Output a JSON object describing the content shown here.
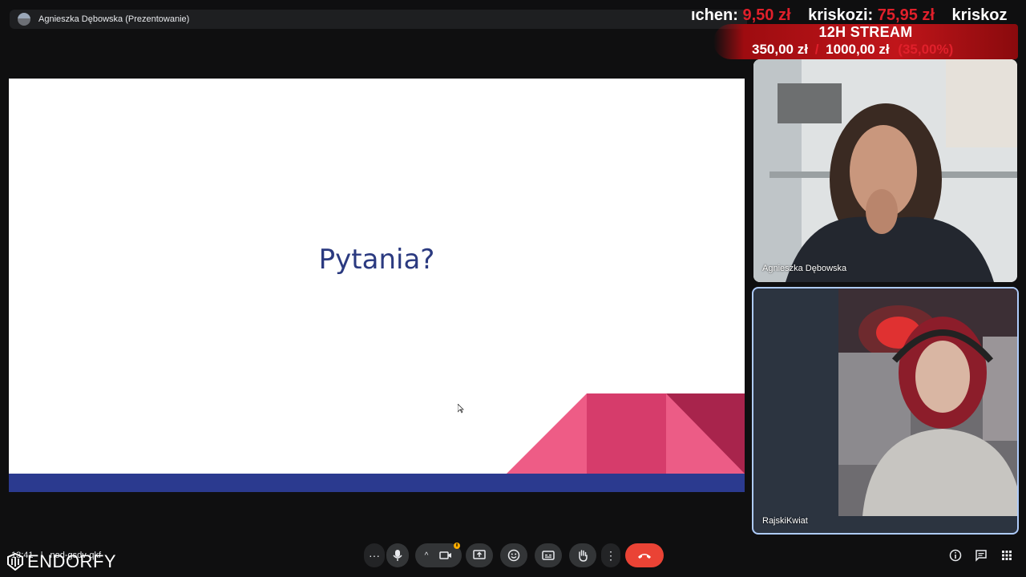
{
  "presenter_bar": {
    "name": "Agnieszka Dębowska (Prezentowanie)"
  },
  "donation_ticker": [
    {
      "name": "ıchen:",
      "amount": "9,50 zł"
    },
    {
      "name": "kriskozi:",
      "amount": "75,95 zł"
    },
    {
      "name": "kriskoz",
      "amount": ""
    }
  ],
  "stream_goal": {
    "title": "12H STREAM",
    "current": "350,00 zł",
    "separator": "/",
    "target": "1000,00 zł",
    "percent": "(35,00%)"
  },
  "slide": {
    "title": "Pytania?"
  },
  "participants": [
    {
      "name": "Agnieszka Dębowska"
    },
    {
      "name": "RajskiKwiat"
    }
  ],
  "meeting_info": {
    "time": "13:41",
    "separator": "|",
    "code": "nod-gsdv-qkf"
  },
  "brand": {
    "logo_text": "ENDORFY"
  },
  "colors": {
    "accent_red": "#e0202b",
    "slide_blue": "#2b3a8f",
    "end_call": "#ea4335"
  }
}
